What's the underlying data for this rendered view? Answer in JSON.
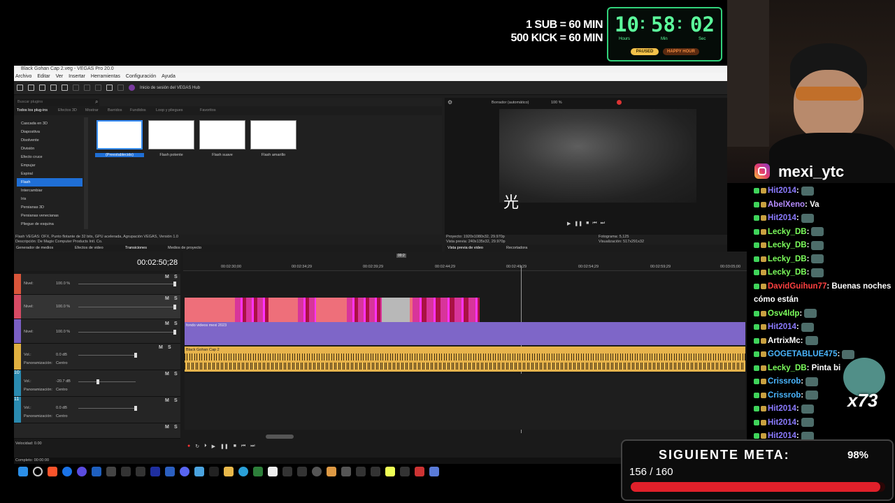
{
  "overlay": {
    "sub_line1": "1 SUB = 60 MIN",
    "sub_line2": "500 KICK = 60 MIN",
    "timer": {
      "hours": "10",
      "minutes": "58",
      "seconds": "02",
      "hours_label": "Hours",
      "minutes_label": "Min",
      "seconds_label": "Sec",
      "paused_label": "PAUSED",
      "happy_label": "HAPPY HOUR",
      "accent": "#5cff9c"
    },
    "instagram": {
      "handle": "mexi_ytc",
      "icon": "instagram-icon"
    },
    "meta": {
      "title": "SIGUIENTE META:",
      "count": "156 / 160",
      "percent": "98%",
      "progress": 0.98,
      "bar_color": "#e0202a"
    },
    "emote_counter": "x73"
  },
  "vegas": {
    "window_title": "Black Gohan Cap 2.veg - VEGAS Pro 20.0",
    "menu": [
      "Archivo",
      "Editar",
      "Ver",
      "Insertar",
      "Herramientas",
      "Configuración",
      "Ayuda"
    ],
    "hub_label": "Inicio de sesión del VEGAS Hub",
    "fx": {
      "search_placeholder": "Buscar plugins",
      "tabs": [
        "Todos los plug-ins",
        "Efectos 3D",
        "Mostrar",
        "Barridos",
        "Fundidos",
        "Loop y pliegues",
        "Favoritos"
      ],
      "list": [
        "Cascada en 3D",
        "Diapositiva",
        "Disolvente",
        "División",
        "Efecto cruce",
        "Empujar",
        "Espiral",
        "Flash",
        "Intercambiar",
        "Iris",
        "Persianas 3D",
        "Persianas venecianas",
        "Pliegue de esquina"
      ],
      "selected": "Flash",
      "presets": [
        "(Preestablecido)",
        "Flash potente",
        "Flash suave",
        "Flash amarillo"
      ],
      "desc1": "Flash VEGAS: OFX, Punto flotante de 32 bits, GPU acelerada, Agrupación VEGAS, Versión 1.0",
      "desc2": "Descripción: De Magix Computer Products Intl. Co.",
      "bottom_tabs": [
        "Generador de medios",
        "Efectos de video",
        "Transiciones",
        "Medios de proyecto"
      ]
    },
    "preview": {
      "mode": "Borrador (automático)",
      "zoom": "100 %",
      "kanji": "光",
      "project_label": "Proyecto:",
      "project_value": "1920x1080x32, 29.970p",
      "preview_label": "Vista previa:",
      "preview_value": "240x135x32, 29.970p",
      "frame_label": "Fotograma:",
      "frame_value": "5,125",
      "display_label": "Visualización:",
      "display_value": "517x291x32",
      "tabs": [
        "Vista previa de video",
        "Recortadora"
      ]
    },
    "timeline": {
      "timecode": "00:02:50;28",
      "ruler": [
        "00:02:30;00",
        "00:02:34;29",
        "00:02:39;29",
        "00:02:44;29",
        "00:02:49;29",
        "00:02:54;29",
        "00:02:59;29",
        "00:03:05;00"
      ],
      "marker": "00:2",
      "tracks": [
        {
          "num": "",
          "color": "#d9553a",
          "label": "Nivel:",
          "value": "100.0 %"
        },
        {
          "num": "",
          "color": "#d64a64",
          "label": "Nivel:",
          "value": "100.0 %"
        },
        {
          "num": "",
          "color": "#7a5fc4",
          "label": "Nivel:",
          "value": "100.0 %"
        },
        {
          "num": "",
          "color": "#e0b040",
          "label": "Vol.:",
          "value": "0.0 dB",
          "pan_label": "Panoramización:",
          "pan": "Centro"
        },
        {
          "num": "10",
          "color": "#2a8ab0",
          "label": "Vol.:",
          "value": "-20.7 dB",
          "pan_label": "Panoramización:",
          "pan": "Centro"
        },
        {
          "num": "11",
          "color": "#2a8ab0",
          "label": "Vol.:",
          "value": "0.0 dB",
          "pan_label": "Panoramización:",
          "pan": "Centro"
        }
      ],
      "purple_clip_label": "fondo videos mexi 2023",
      "audio_clip_label": "Black Gohan Cap 2",
      "rate_label": "Velocidad: 0.00",
      "status": "Completo: 00:00:00"
    }
  },
  "chat": [
    {
      "user": "Hit2014",
      "color": "#8b7bff",
      "msg": "",
      "emote": true
    },
    {
      "user": "AbelXeno",
      "color": "#b58cff",
      "msg": ": Va",
      "emote": false
    },
    {
      "user": "Hit2014",
      "color": "#8b7bff",
      "msg": "",
      "emote": true
    },
    {
      "user": "Lecky_DB",
      "color": "#7cff5c",
      "msg": "",
      "emote": true
    },
    {
      "user": "Lecky_DB",
      "color": "#7cff5c",
      "msg": "",
      "emote": true
    },
    {
      "user": "Lecky_DB",
      "color": "#7cff5c",
      "msg": "",
      "emote": true
    },
    {
      "user": "Lecky_DB",
      "color": "#7cff5c",
      "msg": "",
      "emote": true
    },
    {
      "user": "DavidGuihun77",
      "color": "#ff4040",
      "msg": ": Buenas noches",
      "emote": false,
      "msg2": "cómo están"
    },
    {
      "user": "Osv4ldp",
      "color": "#7cff5c",
      "msg": "",
      "emote": true
    },
    {
      "user": "Hit2014",
      "color": "#8b7bff",
      "msg": "",
      "emote": true
    },
    {
      "user": "ArtrixMc",
      "color": "#ffffff",
      "msg": "",
      "emote": true
    },
    {
      "user": "GOGETABLUE475",
      "color": "#4ab6ff",
      "msg": "",
      "emote": true
    },
    {
      "user": "Lecky_DB",
      "color": "#7cff5c",
      "msg": ": Pinta bi",
      "emote": false
    },
    {
      "user": "Crissrob",
      "color": "#4ab6ff",
      "msg": "",
      "emote": true
    },
    {
      "user": "Crissrob",
      "color": "#4ab6ff",
      "msg": "",
      "emote": true
    },
    {
      "user": "Hit2014",
      "color": "#8b7bff",
      "msg": "",
      "emote": true
    },
    {
      "user": "Hit2014",
      "color": "#8b7bff",
      "msg": "",
      "emote": true
    },
    {
      "user": "Hit2014",
      "color": "#8b7bff",
      "msg": "",
      "emote": true
    }
  ]
}
